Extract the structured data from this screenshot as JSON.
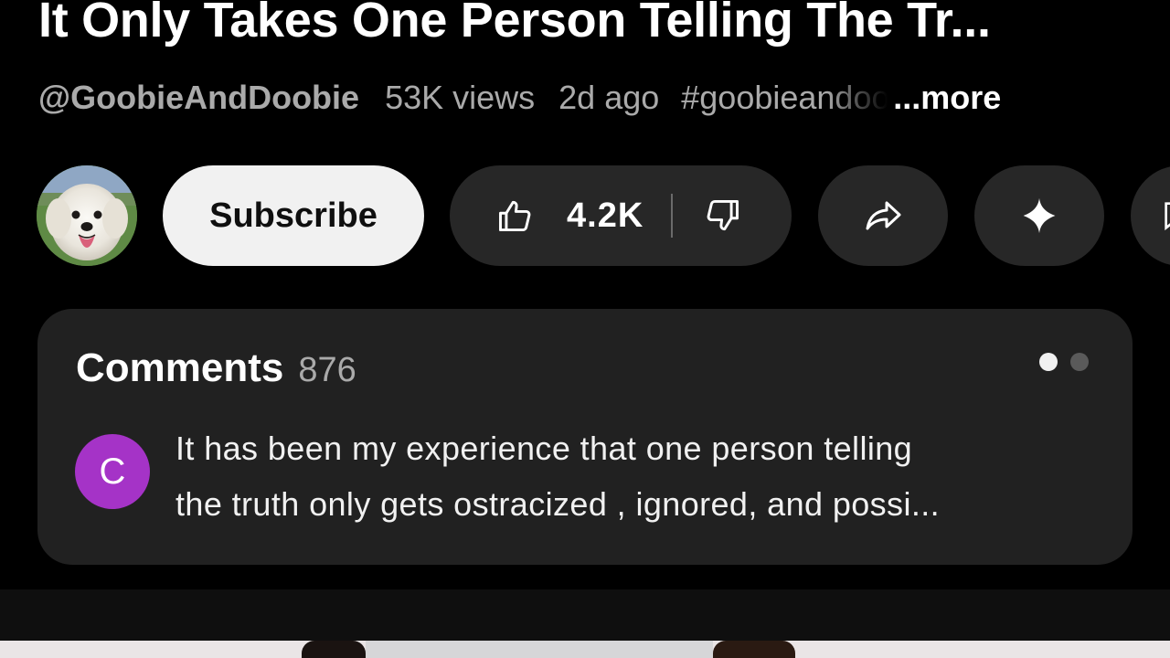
{
  "video": {
    "title": "It Only Takes One Person Telling The Tr...",
    "channel_handle": "@GoobieAndDoobie",
    "views": "53K views",
    "age": "2d ago",
    "hashtag": "#goobieandoobie",
    "more_label": "...more"
  },
  "actions": {
    "subscribe_label": "Subscribe",
    "like_count": "4.2K",
    "icons": {
      "like": "thumbs-up-icon",
      "dislike": "thumbs-down-icon",
      "share": "share-arrow-icon",
      "remix": "sparkle-icon",
      "extra": "comment-bubble-icon"
    }
  },
  "comments": {
    "title": "Comments",
    "count": "876",
    "top_comment": {
      "avatar_letter": "C",
      "avatar_color": "#a533c7",
      "lines": [
        "It has been my experience that one person telling",
        "the truth only gets ostracized , ignored, and possi..."
      ]
    },
    "pager": {
      "total": 2,
      "active": 1
    }
  },
  "colors": {
    "background": "#000000",
    "card": "#212121",
    "pill": "#272727",
    "subscribe_bg": "#f1f1f1",
    "secondary_text": "#aaaaaa"
  }
}
